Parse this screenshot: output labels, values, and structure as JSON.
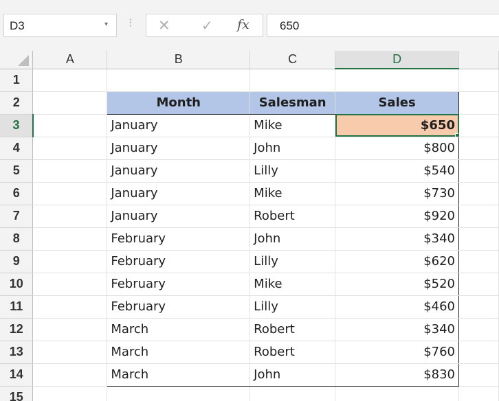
{
  "formula_bar": {
    "name_box": "D3",
    "name_box_arrow": "▾",
    "dots": "⁝",
    "cancel_icon": "✕",
    "enter_icon": "✓",
    "fx_label": "fx",
    "formula_value": "650"
  },
  "columns": [
    "A",
    "B",
    "C",
    "D"
  ],
  "active_cell": "D3",
  "header_fill_color": "#b4c6e7",
  "selected_fill_color": "#f8cbad",
  "table": {
    "headers": [
      "Month",
      "Salesman",
      "Sales"
    ],
    "rows": [
      {
        "month": "January",
        "salesman": "Mike",
        "sales": "$650"
      },
      {
        "month": "January",
        "salesman": "John",
        "sales": "$800"
      },
      {
        "month": "January",
        "salesman": "Lilly",
        "sales": "$540"
      },
      {
        "month": "January",
        "salesman": "Mike",
        "sales": "$730"
      },
      {
        "month": "January",
        "salesman": "Robert",
        "sales": "$920"
      },
      {
        "month": "February",
        "salesman": "John",
        "sales": "$340"
      },
      {
        "month": "February",
        "salesman": "Lilly",
        "sales": "$620"
      },
      {
        "month": "February",
        "salesman": "Mike",
        "sales": "$520"
      },
      {
        "month": "February",
        "salesman": "Lilly",
        "sales": "$460"
      },
      {
        "month": "March",
        "salesman": "Robert",
        "sales": "$340"
      },
      {
        "month": "March",
        "salesman": "Robert",
        "sales": "$760"
      },
      {
        "month": "March",
        "salesman": "John",
        "sales": "$830"
      }
    ]
  },
  "row_numbers": [
    "1",
    "2",
    "3",
    "4",
    "5",
    "6",
    "7",
    "8",
    "9",
    "10",
    "11",
    "12",
    "13",
    "14",
    "15"
  ]
}
